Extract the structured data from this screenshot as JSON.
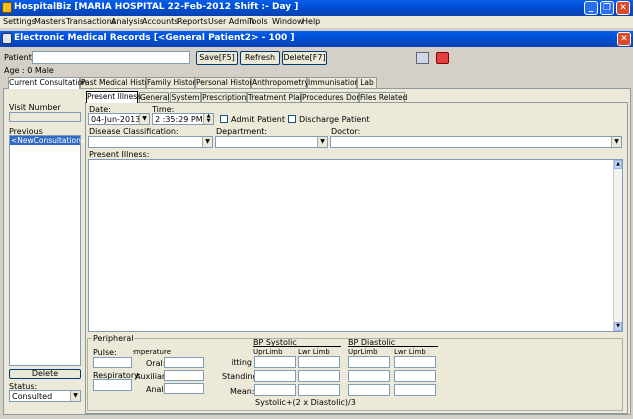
{
  "app": {
    "title": "HospitalBiz [MARIA HOSPITAL  22-Feb-2012   Shift :- Day ]"
  },
  "menu": [
    "Settings",
    "Masters",
    "Transactions",
    "Analysis",
    "Accounts",
    "Reports",
    "User Admin",
    "Tools",
    "Window",
    "Help"
  ],
  "window": {
    "title": "Electronic Medical Records [<General Patient2> - 100 ]"
  },
  "patient": {
    "label": "Patient:",
    "age": "Age : 0 Male"
  },
  "toolbar": {
    "save": "Save[F5]",
    "refresh": "Refresh",
    "delete": "Delete[F7]"
  },
  "main_tabs": [
    "Current Consultation",
    "Past Medical History",
    "Family History",
    "Personal History",
    "Anthropometry",
    "Immunisation",
    "Lab"
  ],
  "sub_tabs": [
    "Present Illness",
    "General",
    "System",
    "Prescriptions",
    "Treatment Plan",
    "Procedures Done",
    "Files Related"
  ],
  "left": {
    "visit_number": "Visit Number",
    "previous": "Previous",
    "new_consultation": "<NewConsultation>",
    "delete": "Delete",
    "status_label": "Status:",
    "status_value": "Consulted"
  },
  "form": {
    "date_label": "Date:",
    "date_value": "04-Jun-2013",
    "time_label": "Time:",
    "time_value": "2 :35:29 PM",
    "admit": "Admit Patient",
    "discharge": "Discharge Patient",
    "disease": "Disease Classification:",
    "department": "Department:",
    "doctor": "Doctor:",
    "present_illness": "Present Illness:"
  },
  "peripheral": {
    "title": "Peripheral",
    "pulse": "Pulse:",
    "respiratory": "Respiratory:",
    "temperature": "Temperature:",
    "oral": "Oral:",
    "auxiliary": "Auxiliary:",
    "anal": "Anal:",
    "bp_systolic": "BP Systolic",
    "bp_diastolic": "BP Diastolic",
    "upr_limb": "UprLimb",
    "lwr_limb": "Lwr Limb",
    "sitting": "Sitting:",
    "standing": "Standing:",
    "mean": "Mean:",
    "formula": "Systolic+(2 x Diastolic)/3"
  }
}
